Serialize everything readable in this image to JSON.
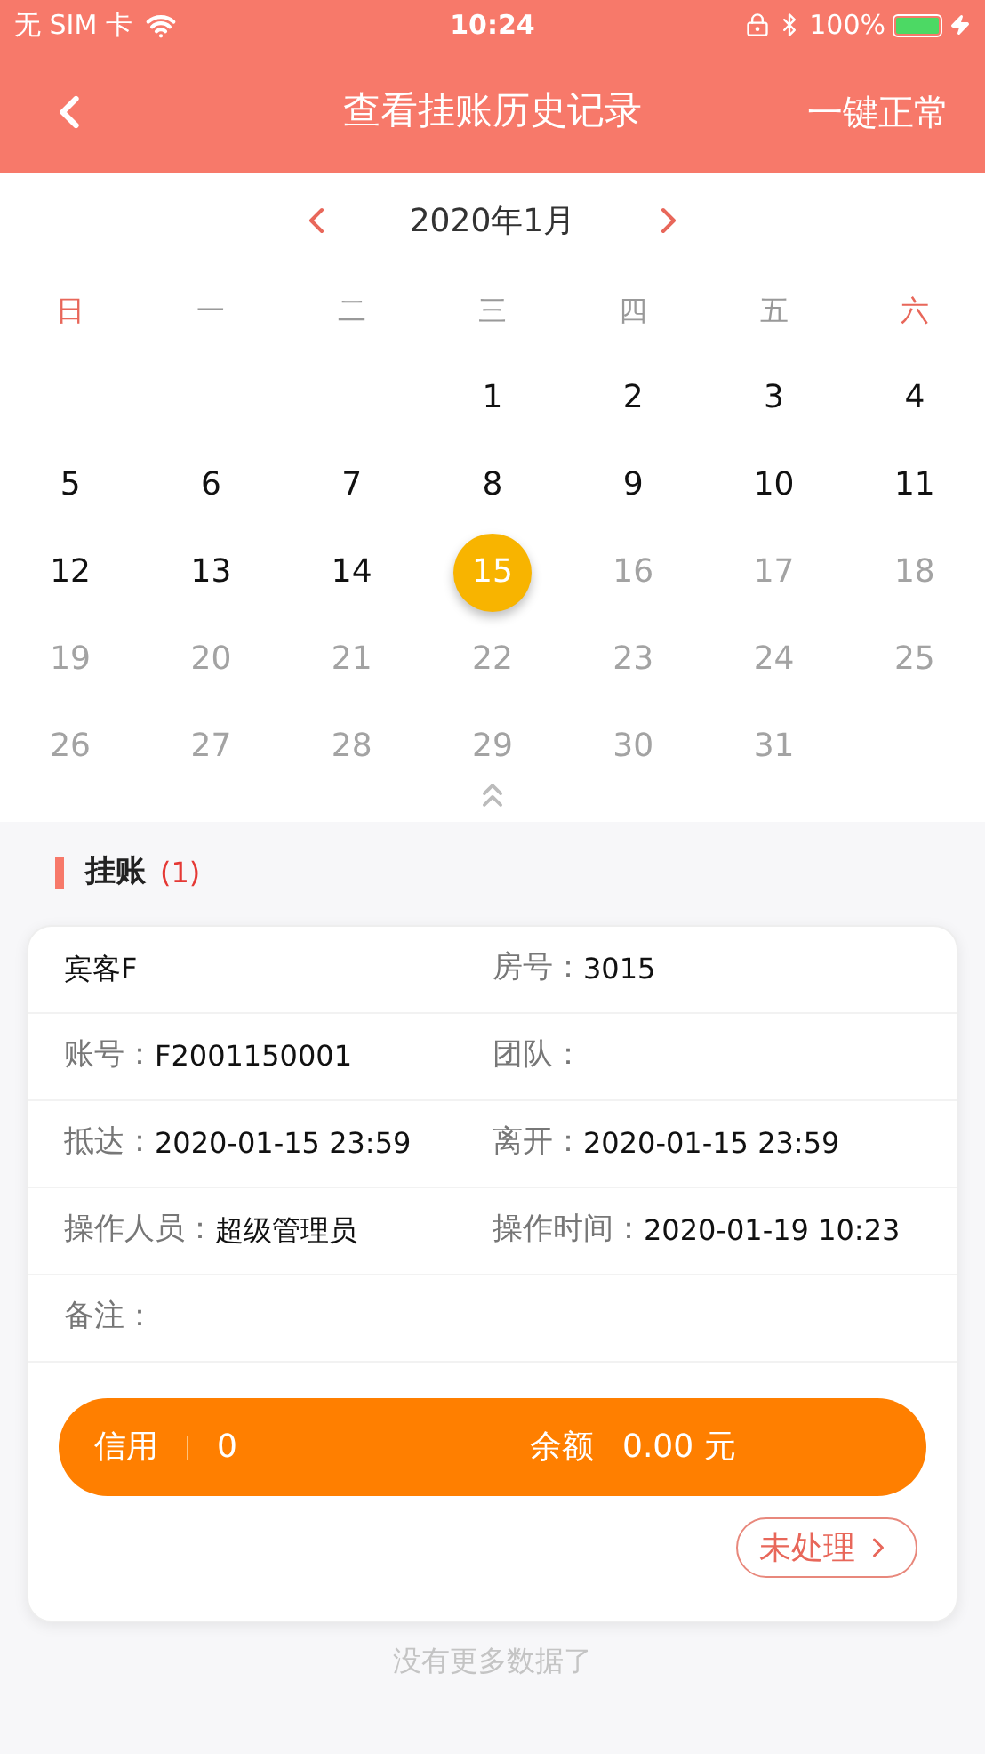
{
  "status_bar": {
    "carrier": "无 SIM 卡",
    "time": "10:24",
    "battery": "100%"
  },
  "nav": {
    "title": "查看挂账历史记录",
    "action": "一键正常"
  },
  "calendar": {
    "month": "2020年1月",
    "weekdays": [
      {
        "label": "日",
        "weekend": true
      },
      {
        "label": "一",
        "weekend": false
      },
      {
        "label": "二",
        "weekend": false
      },
      {
        "label": "三",
        "weekend": false
      },
      {
        "label": "四",
        "weekend": false
      },
      {
        "label": "五",
        "weekend": false
      },
      {
        "label": "六",
        "weekend": true
      }
    ],
    "weeks": [
      [
        {
          "kind": "empty"
        },
        {
          "kind": "empty"
        },
        {
          "kind": "empty"
        },
        {
          "kind": "day",
          "text": "1",
          "selected": false,
          "disabled": false
        },
        {
          "kind": "day",
          "text": "2",
          "selected": false,
          "disabled": false
        },
        {
          "kind": "day",
          "text": "3",
          "selected": false,
          "disabled": false
        },
        {
          "kind": "day",
          "text": "4",
          "selected": false,
          "disabled": false
        }
      ],
      [
        {
          "kind": "day",
          "text": "5",
          "selected": false,
          "disabled": false
        },
        {
          "kind": "day",
          "text": "6",
          "selected": false,
          "disabled": false
        },
        {
          "kind": "day",
          "text": "7",
          "selected": false,
          "disabled": false
        },
        {
          "kind": "day",
          "text": "8",
          "selected": false,
          "disabled": false
        },
        {
          "kind": "day",
          "text": "9",
          "selected": false,
          "disabled": false
        },
        {
          "kind": "day",
          "text": "10",
          "selected": false,
          "disabled": false
        },
        {
          "kind": "day",
          "text": "11",
          "selected": false,
          "disabled": false
        }
      ],
      [
        {
          "kind": "day",
          "text": "12",
          "selected": false,
          "disabled": false
        },
        {
          "kind": "day",
          "text": "13",
          "selected": false,
          "disabled": false
        },
        {
          "kind": "day",
          "text": "14",
          "selected": false,
          "disabled": false
        },
        {
          "kind": "day",
          "text": "15",
          "selected": true,
          "disabled": false
        },
        {
          "kind": "day",
          "text": "16",
          "selected": false,
          "disabled": true
        },
        {
          "kind": "day",
          "text": "17",
          "selected": false,
          "disabled": true
        },
        {
          "kind": "day",
          "text": "18",
          "selected": false,
          "disabled": true
        }
      ],
      [
        {
          "kind": "day",
          "text": "19",
          "selected": false,
          "disabled": true
        },
        {
          "kind": "day",
          "text": "20",
          "selected": false,
          "disabled": true
        },
        {
          "kind": "day",
          "text": "21",
          "selected": false,
          "disabled": true
        },
        {
          "kind": "day",
          "text": "22",
          "selected": false,
          "disabled": true
        },
        {
          "kind": "day",
          "text": "23",
          "selected": false,
          "disabled": true
        },
        {
          "kind": "day",
          "text": "24",
          "selected": false,
          "disabled": true
        },
        {
          "kind": "day",
          "text": "25",
          "selected": false,
          "disabled": true
        }
      ],
      [
        {
          "kind": "day",
          "text": "26",
          "selected": false,
          "disabled": true
        },
        {
          "kind": "day",
          "text": "27",
          "selected": false,
          "disabled": true
        },
        {
          "kind": "day",
          "text": "28",
          "selected": false,
          "disabled": true
        },
        {
          "kind": "day",
          "text": "29",
          "selected": false,
          "disabled": true
        },
        {
          "kind": "day",
          "text": "30",
          "selected": false,
          "disabled": true
        },
        {
          "kind": "day",
          "text": "31",
          "selected": false,
          "disabled": true
        },
        {
          "kind": "empty"
        }
      ]
    ]
  },
  "section": {
    "title": "挂账",
    "count": "(1)"
  },
  "record": {
    "rows": [
      {
        "cells": [
          {
            "value": "宾客F"
          },
          {
            "label": "房号：",
            "value": "3015"
          }
        ]
      },
      {
        "cells": [
          {
            "label": "账号：",
            "value": "F2001150001"
          },
          {
            "label": "团队："
          }
        ]
      },
      {
        "cells": [
          {
            "label": "抵达：",
            "value": "2020-01-15 23:59"
          },
          {
            "label": "离开：",
            "value": "2020-01-15 23:59"
          }
        ]
      },
      {
        "cells": [
          {
            "label": "操作人员：",
            "value": "超级管理员"
          },
          {
            "label": "操作时间：",
            "value": "2020-01-19 10:23"
          }
        ]
      },
      {
        "cells": [
          {
            "label": "备注："
          }
        ]
      }
    ],
    "credit_label": "信用",
    "credit": "0",
    "balance_label": "余额",
    "balance": "0.00 元",
    "status": "未处理"
  },
  "footer": "没有更多数据了"
}
